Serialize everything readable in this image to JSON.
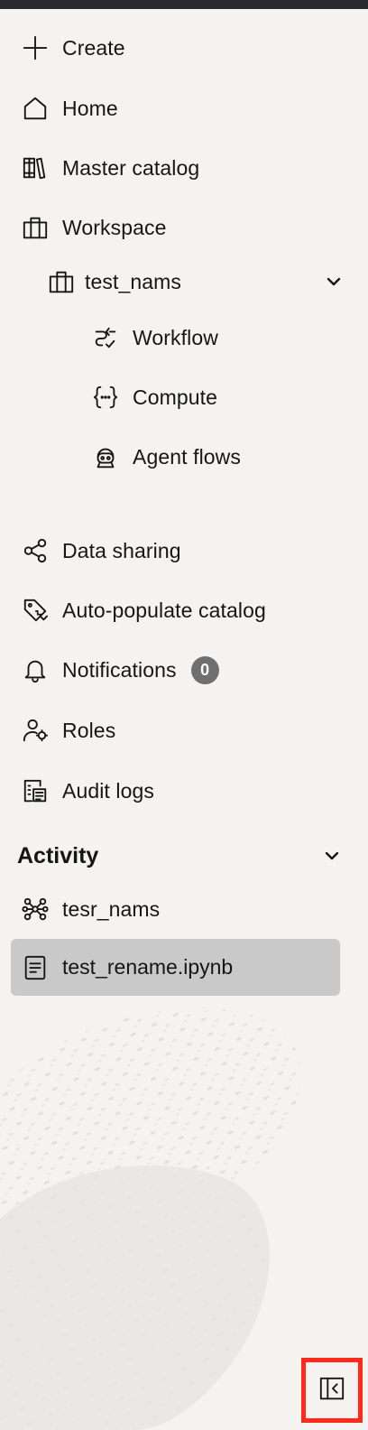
{
  "sidebar": {
    "items": [
      {
        "label": "Create",
        "icon": "plus-icon"
      },
      {
        "label": "Home",
        "icon": "home-icon"
      },
      {
        "label": "Master catalog",
        "icon": "catalog-icon"
      },
      {
        "label": "Workspace",
        "icon": "workspace-icon"
      }
    ],
    "workspace": {
      "label": "test_nams",
      "icon": "workspace-icon",
      "expanded": true,
      "children": [
        {
          "label": "Workflow",
          "icon": "workflow-icon"
        },
        {
          "label": "Compute",
          "icon": "compute-icon"
        },
        {
          "label": "Agent flows",
          "icon": "agent-icon"
        }
      ]
    },
    "items2": [
      {
        "label": "Data sharing",
        "icon": "share-icon"
      },
      {
        "label": "Auto-populate catalog",
        "icon": "tag-icon"
      },
      {
        "label": "Notifications",
        "icon": "bell-icon",
        "badge": "0"
      },
      {
        "label": "Roles",
        "icon": "roles-icon"
      },
      {
        "label": "Audit logs",
        "icon": "audit-icon"
      }
    ]
  },
  "activity": {
    "title": "Activity",
    "expanded": true,
    "items": [
      {
        "label": "tesr_nams",
        "icon": "nodes-icon"
      },
      {
        "label": "test_rename.ipynb",
        "icon": "notebook-icon",
        "active": true
      }
    ]
  },
  "colors": {
    "background": "#f4f3f2",
    "active_item": "#c9c9c9",
    "badge": "#6f6f6f",
    "highlight": "#ff2a1a"
  }
}
